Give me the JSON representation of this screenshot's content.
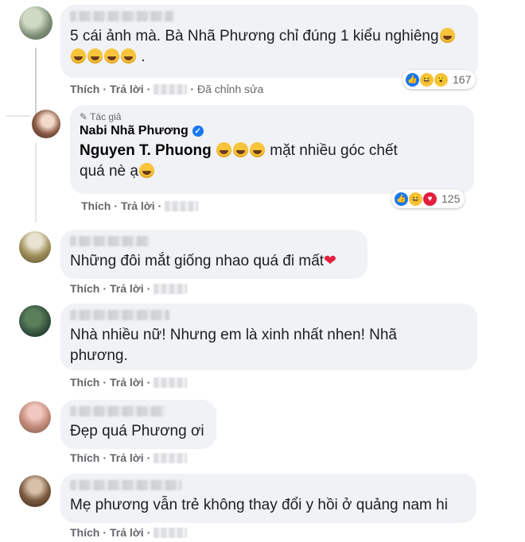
{
  "comments": [
    {
      "text": "5 cái ảnh mà. Bà Nhã Phương chỉ đúng 1 kiểu nghiêng",
      "actions": {
        "like": "Thích",
        "reply": "Trả lời",
        "edited": "Đã chỉnh sửa"
      },
      "reactions": {
        "count": "167",
        "types": [
          "like-icon",
          "haha-icon",
          "wow-icon"
        ]
      }
    },
    {
      "author_tag": "Tác giả",
      "author": "Nabi Nhã Phương",
      "mention": "Nguyen T. Phuong",
      "text_after_mention": "mặt nhiều góc chết",
      "text_line2": "quá nè ạ",
      "actions": {
        "like": "Thích",
        "reply": "Trả lời"
      },
      "reactions": {
        "count": "125",
        "types": [
          "like-icon",
          "haha-icon",
          "love-icon"
        ]
      }
    },
    {
      "text": "Những đôi mắt giống nhao quá đi mất",
      "actions": {
        "like": "Thích",
        "reply": "Trả lời"
      }
    },
    {
      "text_line1": "Nhà nhiều nữ! Nhưng em là xinh nhất nhen! Nhã",
      "text_line2": "phương.",
      "actions": {
        "like": "Thích",
        "reply": "Trả lời"
      }
    },
    {
      "text": "Đẹp quá Phương ơi",
      "actions": {
        "like": "Thích",
        "reply": "Trả lời"
      }
    },
    {
      "text": "Mẹ phương vẫn trẻ không thay đổi y hồi ở quảng nam hi",
      "actions": {
        "like": "Thích",
        "reply": "Trả lời"
      }
    }
  ],
  "separator": "·",
  "colors": {
    "bubble": "#f0f2f5",
    "meta": "#65676b",
    "like": "#1877f2",
    "love": "#e41e3f",
    "haha": "#f7c43a"
  }
}
